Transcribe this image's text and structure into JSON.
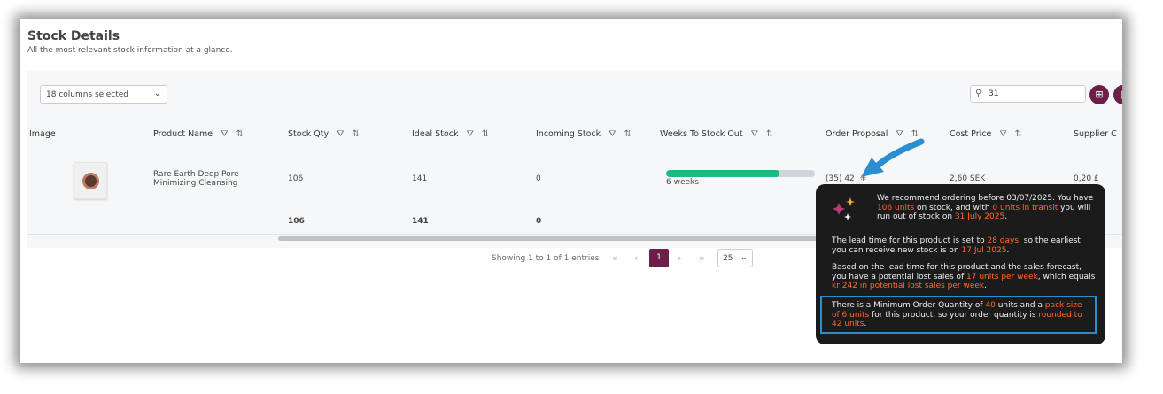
{
  "header": {
    "title": "Stock Details",
    "subtitle": "All the most relevant stock information at a glance."
  },
  "toolbar": {
    "columns_selected": "18 columns selected",
    "search_value": "31"
  },
  "table": {
    "columns": [
      "Image",
      "Product Name",
      "Stock Qty",
      "Ideal Stock",
      "Incoming Stock",
      "Weeks To Stock Out",
      "Order Proposal",
      "Cost Price",
      "Supplier C"
    ],
    "row": {
      "product_name": "Rare Earth Deep Pore Minimizing Cleansing",
      "stock_qty": "106",
      "ideal_stock": "141",
      "incoming_stock": "0",
      "weeks_to_stock_out": "6 weeks",
      "weeks_progress": 0.76,
      "order_proposal": "(35) 42",
      "cost_price": "2,60 SEK",
      "supplier_cost": "0,20 £"
    },
    "totals": {
      "stock_qty": "106",
      "ideal_stock": "141",
      "incoming_stock": "0"
    }
  },
  "pagination": {
    "info": "Showing 1 to 1 of 1 entries",
    "current_page": "1",
    "page_size": "25"
  },
  "tooltip": {
    "p1_a": "We recommend ordering before 03/07/2025. You have ",
    "p1_b": "106 units",
    "p1_c": " on stock, and with ",
    "p1_d": "0 units in transit",
    "p1_e": " you will run out of stock on ",
    "p1_f": "31 July 2025",
    "p1_g": ".",
    "p2_a": "The lead time for this product is set to ",
    "p2_b": "28 days",
    "p2_c": ", so the earliest you can receive new stock is on ",
    "p2_d": "17 Jul 2025",
    "p2_e": ".",
    "p3_a": "Based on the lead time for this product and the sales forecast, you have a potential lost sales of ",
    "p3_b": "17 units per week",
    "p3_c": ", which equals ",
    "p3_d": "kr 242 in potential lost sales per week",
    "p3_e": ".",
    "p4_a": "There is a Minimum Order Quantity of ",
    "p4_b": "40",
    "p4_c": " units and a ",
    "p4_d": "pack size of 6 units",
    "p4_e": " for this product, so your order quantity is ",
    "p4_f": "rounded to 42 units",
    "p4_g": "."
  },
  "colors": {
    "accent": "#6d1f4a",
    "progress": "#1eb980",
    "highlight": "#ff6a2b",
    "annotation_arrow": "#2a8fd1"
  }
}
